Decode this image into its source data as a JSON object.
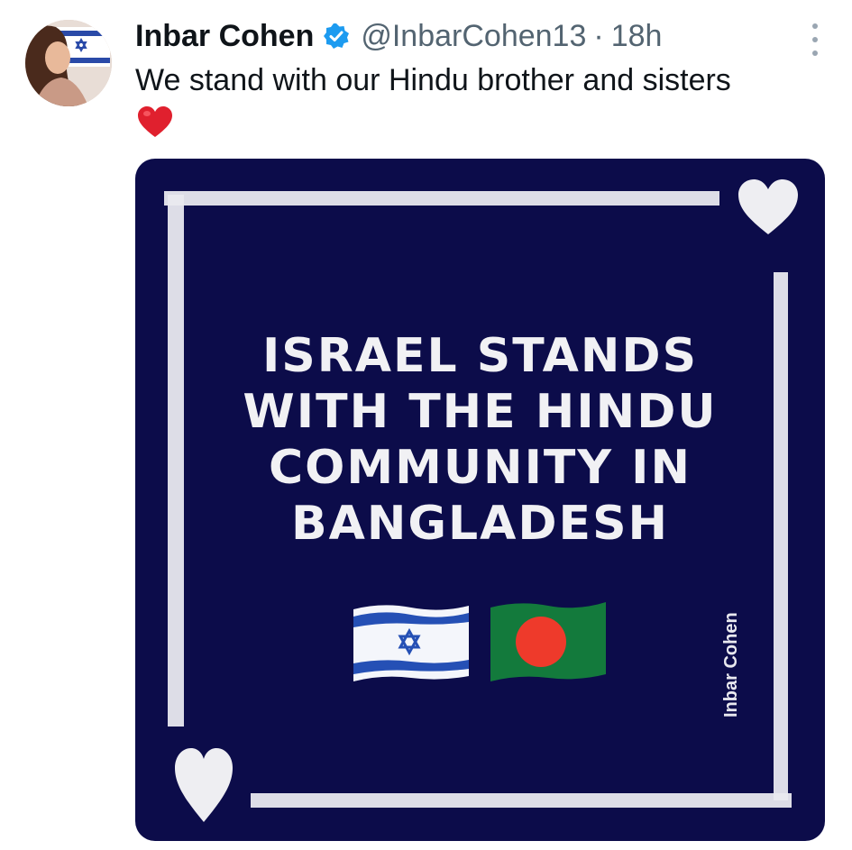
{
  "author": {
    "name": "Inbar Cohen",
    "handle": "@InbarCohen13",
    "separator": "·",
    "time": "18h",
    "verified": true,
    "avatar_icon": "profile-photo-with-israel-flag"
  },
  "tweet": {
    "text": "We stand with our Hindu brother and sisters",
    "emoji": "red-heart"
  },
  "media": {
    "background_color": "#0c0c4a",
    "headline_lines": [
      "ISRAEL STANDS",
      "WITH THE HINDU",
      "COMMUNITY IN",
      "BANGLADESH"
    ],
    "flags": [
      "israel-flag",
      "bangladesh-flag"
    ],
    "watermark": "Inbar Cohen"
  },
  "colors": {
    "verified": "#1d9bf0",
    "secondary_text": "#536471",
    "heart": "#e0202e"
  }
}
